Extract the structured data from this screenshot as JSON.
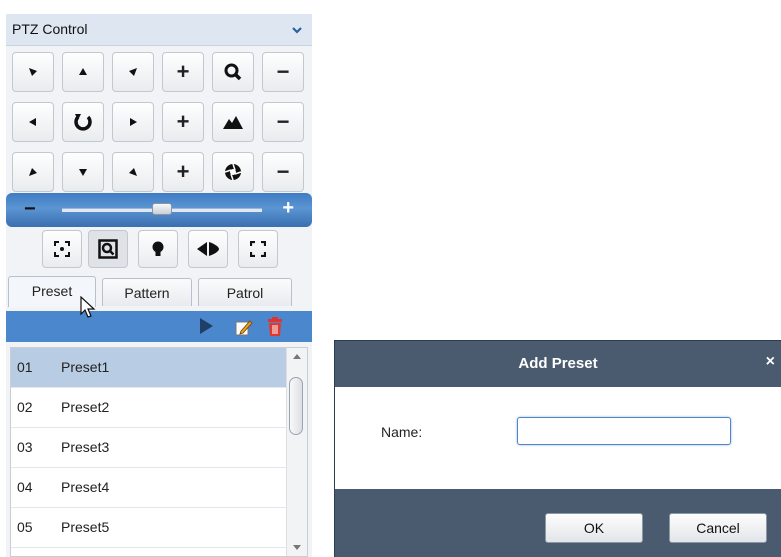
{
  "ptz": {
    "title": "PTZ Control",
    "collapse_icon": "chevron-down-icon",
    "direction_buttons": [
      {
        "icon": "arrow-up-left-icon"
      },
      {
        "icon": "arrow-up-icon"
      },
      {
        "icon": "arrow-up-right-icon"
      },
      {
        "icon": "arrow-left-icon"
      },
      {
        "icon": "auto-scan-icon"
      },
      {
        "icon": "arrow-right-icon"
      },
      {
        "icon": "arrow-down-left-icon"
      },
      {
        "icon": "arrow-down-icon"
      },
      {
        "icon": "arrow-down-right-icon"
      }
    ],
    "adjust_rows": [
      {
        "function": "zoom",
        "icon": "zoom-icon",
        "plus": "+",
        "minus": "−"
      },
      {
        "function": "focus",
        "icon": "focus-icon",
        "plus": "+",
        "minus": "−"
      },
      {
        "function": "iris",
        "icon": "iris-icon",
        "plus": "+",
        "minus": "−"
      }
    ],
    "speed": {
      "minus": "−",
      "plus": "+",
      "level": 0.5
    },
    "function_buttons": [
      {
        "name": "3d-positioning",
        "icon": "3d-position-icon"
      },
      {
        "name": "region-zoom",
        "icon": "region-zoom-icon"
      },
      {
        "name": "light",
        "icon": "light-icon"
      },
      {
        "name": "wiper",
        "icon": "wiper-icon"
      },
      {
        "name": "lens-init",
        "icon": "lens-init-icon"
      }
    ],
    "tabs": [
      {
        "label": "Preset",
        "active": true
      },
      {
        "label": "Pattern",
        "active": false
      },
      {
        "label": "Patrol",
        "active": false
      }
    ],
    "toolbar": {
      "icons": [
        "play-icon",
        "edit-icon",
        "delete-icon"
      ]
    },
    "presets": [
      {
        "num": "01",
        "name": "Preset1",
        "selected": true
      },
      {
        "num": "02",
        "name": "Preset2",
        "selected": false
      },
      {
        "num": "03",
        "name": "Preset3",
        "selected": false
      },
      {
        "num": "04",
        "name": "Preset4",
        "selected": false
      },
      {
        "num": "05",
        "name": "Preset5",
        "selected": false
      }
    ]
  },
  "dialog": {
    "title": "Add Preset",
    "close": "×",
    "name_label": "Name:",
    "name_value": "",
    "ok": "OK",
    "cancel": "Cancel"
  },
  "colors": {
    "accent_blue": "#4a87cc",
    "dialog_bar": "#4a5b70",
    "selected_row": "#b8cde4"
  }
}
